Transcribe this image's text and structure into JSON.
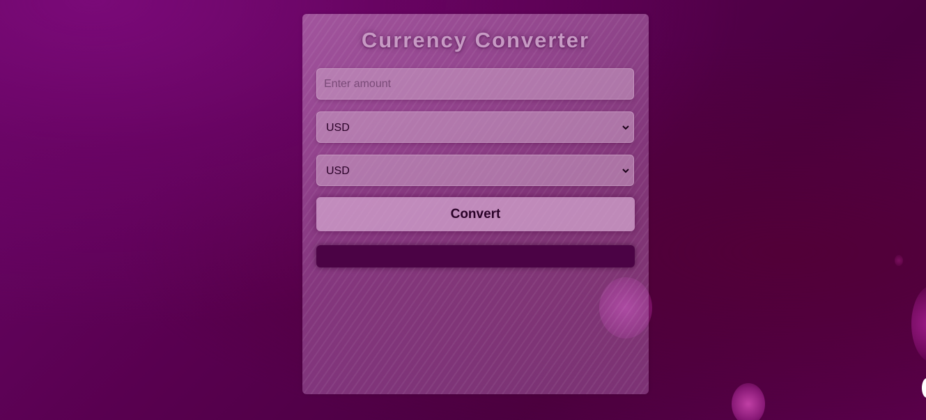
{
  "app": {
    "title": "Currency Converter"
  },
  "form": {
    "amount_placeholder": "Enter amount",
    "amount_value": "",
    "from_currency": "USD",
    "to_currency": "USD",
    "convert_label": "Convert",
    "result_text": ""
  },
  "icons": {
    "select_arrow": "chevron-down-icon"
  },
  "colors": {
    "result_bar": "#4b0345",
    "text": "#2a0228"
  }
}
